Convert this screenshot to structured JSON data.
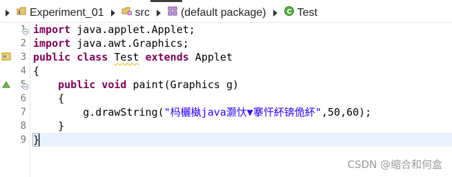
{
  "breadcrumb": {
    "items": [
      {
        "label": "Experiment_01",
        "icon": "java-project-icon"
      },
      {
        "label": "src",
        "icon": "source-folder-icon"
      },
      {
        "label": "(default package)",
        "icon": "package-icon"
      },
      {
        "label": "Test",
        "icon": "java-class-icon"
      }
    ]
  },
  "editor": {
    "line_numbers": [
      "1",
      "2",
      "3",
      "4",
      "5",
      "6",
      "7",
      "8",
      "9"
    ],
    "lines": [
      {
        "kw": "import",
        "rest": " java.applet.Applet;"
      },
      {
        "kw": "import",
        "rest": " java.awt.Graphics;"
      },
      {
        "kw1": "public",
        "kw2": "class",
        "name": "Test",
        "kw3": "extends",
        "rest": " Applet"
      },
      {
        "text": "{"
      },
      {
        "indent": "    ",
        "kw1": "public",
        "kw2": "void",
        "rest": " paint(Graphics g)"
      },
      {
        "text": "    {"
      },
      {
        "pre": "        g.drawString(",
        "str": "\"杩欐槸java灏忕▼搴忓紑锛佹紑\"",
        "post": ",50,60);"
      },
      {
        "text": "    }"
      },
      {
        "text": "}"
      }
    ],
    "current_line": 9
  },
  "colors": {
    "keyword": "#7f0055",
    "string": "#2a00ff",
    "current_line_bg": "#e8f2fe"
  },
  "watermark": "CSDN @缩合和何盒"
}
